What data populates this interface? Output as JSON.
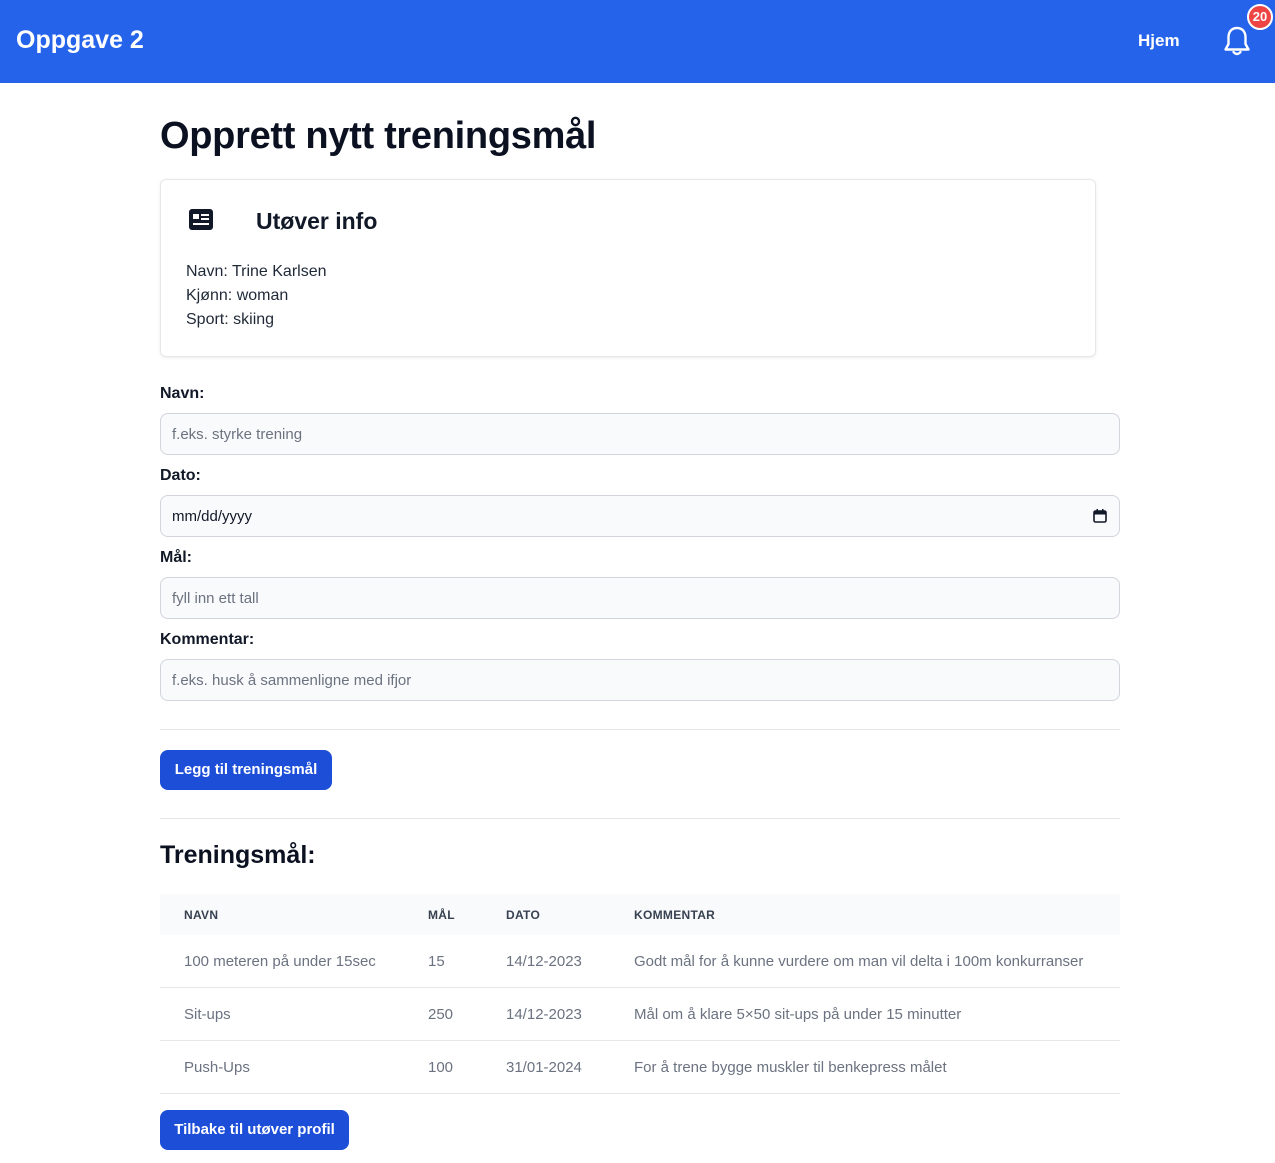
{
  "navbar": {
    "brand": "Oppgave 2",
    "home_link": "Hjem",
    "notification_count": "20"
  },
  "page": {
    "title": "Opprett nytt treningsmål"
  },
  "athlete_card": {
    "title": "Utøver info",
    "icon": "id-card-icon",
    "lines": [
      "Navn: Trine Karlsen",
      "Kjønn: woman",
      "Sport: skiing"
    ]
  },
  "form": {
    "name_label": "Navn:",
    "name_placeholder": "f.eks. styrke trening",
    "date_label": "Dato:",
    "date_placeholder": "mm/dd/yyyy",
    "goal_label": "Mål:",
    "goal_placeholder": "fyll inn ett tall",
    "comment_label": "Kommentar:",
    "comment_placeholder": "f.eks. husk å sammenligne med ifjor",
    "submit_label": "Legg til treningsmål"
  },
  "goals": {
    "title": "Treningsmål:",
    "columns": [
      "NAVN",
      "MÅL",
      "DATO",
      "KOMMENTAR"
    ],
    "rows": [
      [
        "100 meteren på under 15sec",
        "15",
        "14/12-2023",
        "Godt mål for å kunne vurdere om man vil delta i 100m konkurranser"
      ],
      [
        "Sit-ups",
        "250",
        "14/12-2023",
        "Mål om å klare 5×50 sit-ups på under 15 minutter"
      ],
      [
        "Push-Ups",
        "100",
        "31/01-2024",
        "For å trene bygge muskler til benkepress målet"
      ]
    ]
  },
  "back_button": "Tilbake til utøver profil",
  "colors": {
    "navbar": "#2563eb",
    "button": "#1d4ed8",
    "badge": "#ef4444"
  }
}
